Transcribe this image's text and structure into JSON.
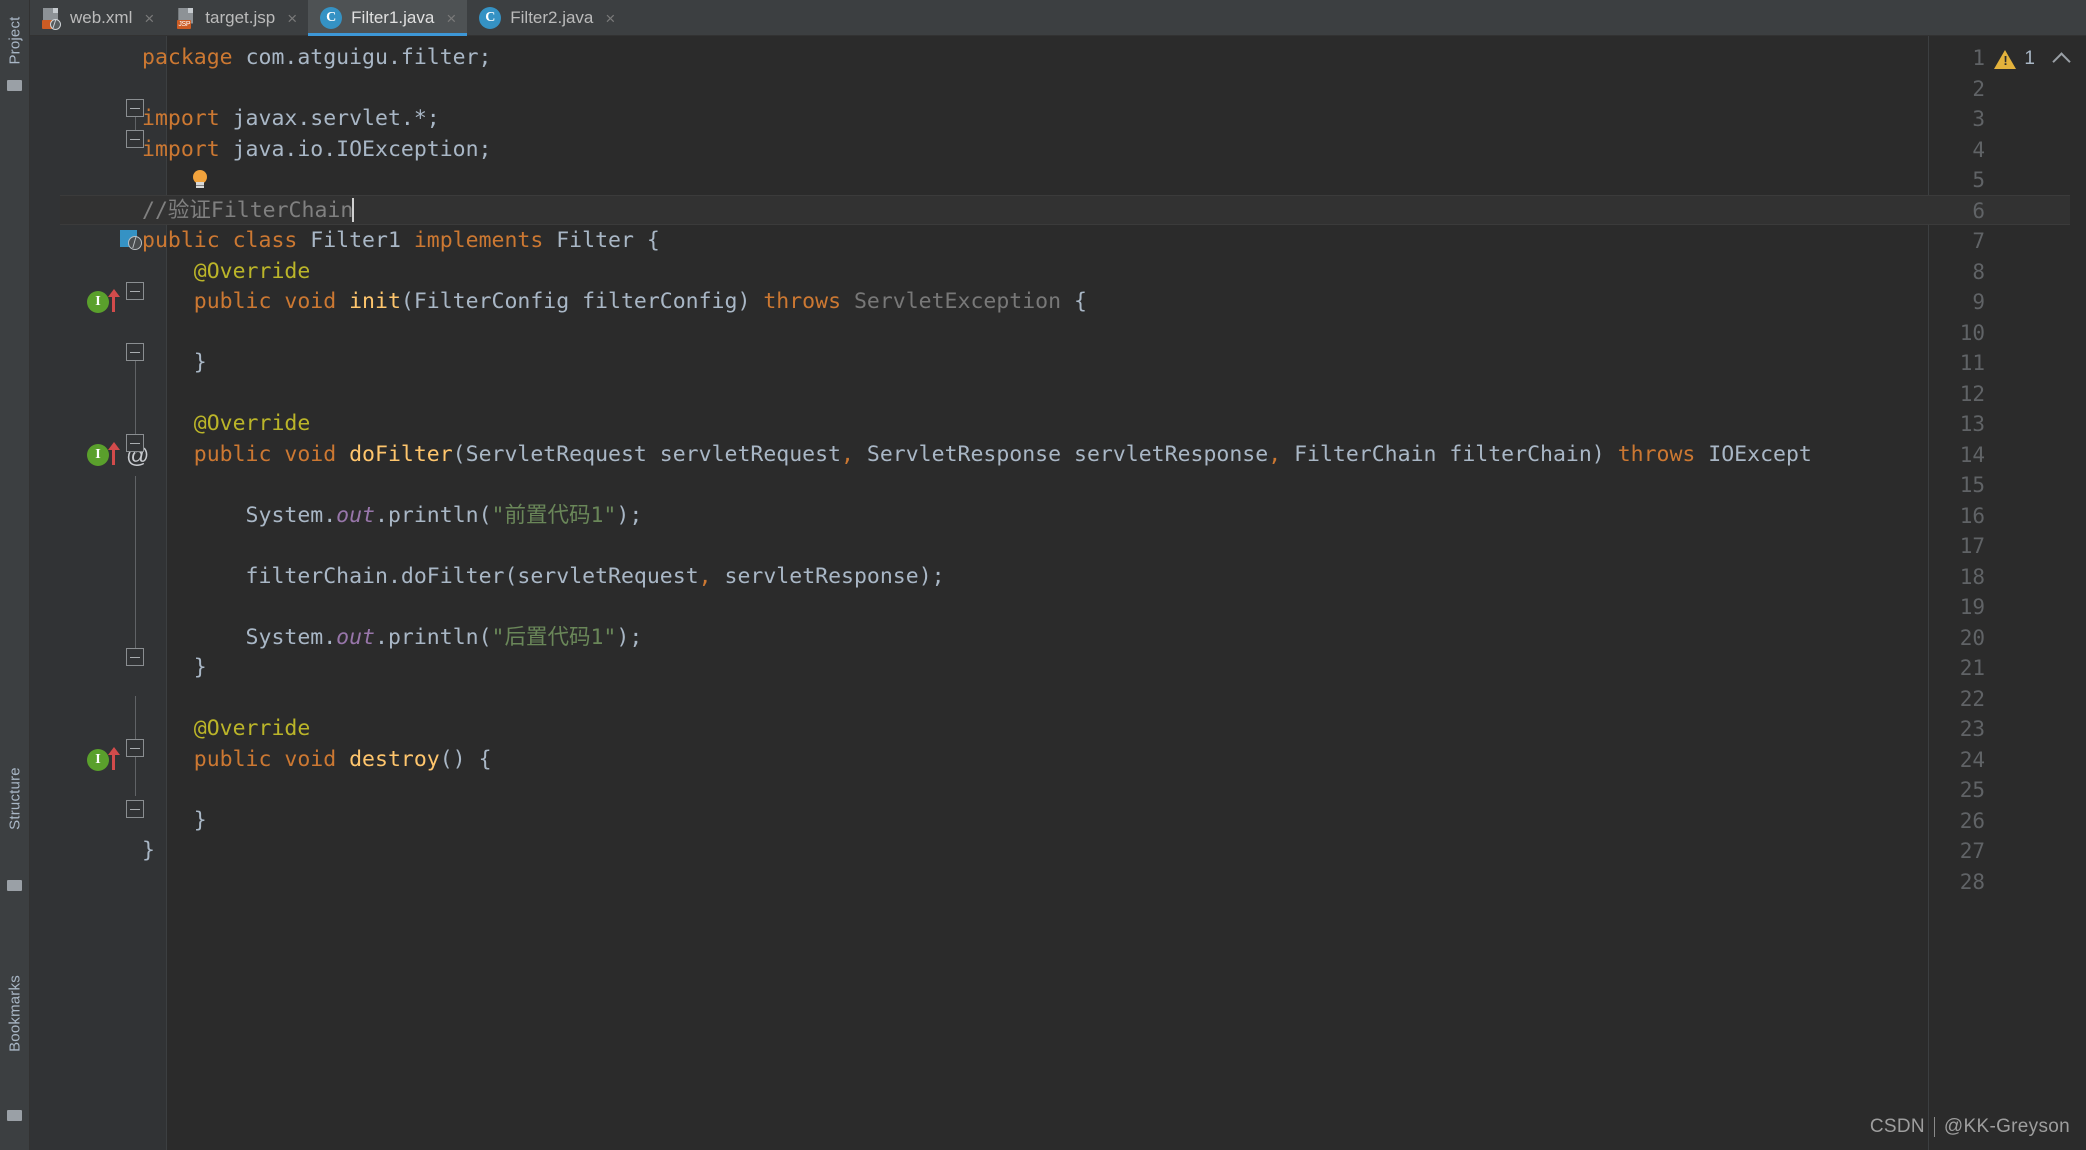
{
  "window": {
    "theme_bg": "#2b2b2b",
    "gutter_bg": "#313335",
    "accent": "#3d97d7"
  },
  "left_rail": {
    "labels": [
      {
        "name": "project",
        "text": "Project"
      },
      {
        "name": "structure",
        "text": "Structure"
      },
      {
        "name": "bookmarks",
        "text": "Bookmarks"
      }
    ]
  },
  "tabs": [
    {
      "label": "web.xml",
      "icon": "xml-file-icon",
      "badge": "",
      "active": false,
      "close": "×"
    },
    {
      "label": "target.jsp",
      "icon": "jsp-file-icon",
      "badge": "JSP",
      "active": false,
      "close": "×"
    },
    {
      "label": "Filter1.java",
      "icon": "java-class-icon",
      "badge": "C",
      "active": true,
      "close": "×"
    },
    {
      "label": "Filter2.java",
      "icon": "java-class-icon",
      "badge": "C",
      "active": false,
      "close": "×"
    }
  ],
  "inspection_widget": {
    "warning_count": "1",
    "icon": "warning-triangle-icon",
    "collapse_icon": "chevron-up-icon"
  },
  "editor": {
    "caret_line": 6,
    "lines": [
      {
        "n": "1",
        "segments": [
          {
            "t": "package ",
            "c": "kw"
          },
          {
            "t": "com.atguigu.filter;",
            "c": "punct"
          }
        ]
      },
      {
        "n": "2",
        "segments": []
      },
      {
        "n": "3",
        "segments": [
          {
            "t": "import ",
            "c": "kw"
          },
          {
            "t": "javax.servlet.*;",
            "c": "punct"
          }
        ]
      },
      {
        "n": "4",
        "segments": [
          {
            "t": "import ",
            "c": "kw"
          },
          {
            "t": "java.io.IOException;",
            "c": "punct"
          }
        ]
      },
      {
        "n": "5",
        "segments": []
      },
      {
        "n": "6",
        "segments": [
          {
            "t": "//验证FilterChain",
            "c": "cmt"
          }
        ],
        "caret": true
      },
      {
        "n": "7",
        "segments": [
          {
            "t": "public class ",
            "c": "kw"
          },
          {
            "t": "Filter1 ",
            "c": "punct"
          },
          {
            "t": "implements ",
            "c": "kw"
          },
          {
            "t": "Filter ",
            "c": "punct"
          },
          {
            "t": "{",
            "c": "punct"
          }
        ]
      },
      {
        "n": "8",
        "segments": [
          {
            "t": "    @Override",
            "c": "anno"
          }
        ]
      },
      {
        "n": "9",
        "segments": [
          {
            "t": "    public void ",
            "c": "kw"
          },
          {
            "t": "init",
            "c": "mth"
          },
          {
            "t": "(",
            "c": "punct"
          },
          {
            "t": "FilterConfig filterConfig",
            "c": "punct"
          },
          {
            "t": ") ",
            "c": "punct"
          },
          {
            "t": "throws ",
            "c": "kw"
          },
          {
            "t": "ServletException ",
            "c": "dim"
          },
          {
            "t": "{",
            "c": "punct"
          }
        ]
      },
      {
        "n": "10",
        "segments": []
      },
      {
        "n": "11",
        "segments": [
          {
            "t": "    }",
            "c": "punct"
          }
        ]
      },
      {
        "n": "12",
        "segments": []
      },
      {
        "n": "13",
        "segments": [
          {
            "t": "    @Override",
            "c": "anno"
          }
        ]
      },
      {
        "n": "14",
        "segments": [
          {
            "t": "    public void ",
            "c": "kw"
          },
          {
            "t": "doFilter",
            "c": "mth"
          },
          {
            "t": "(",
            "c": "punct"
          },
          {
            "t": "ServletRequest servletRequest",
            "c": "punct"
          },
          {
            "t": ", ",
            "c": "kw"
          },
          {
            "t": "ServletResponse servletResponse",
            "c": "punct"
          },
          {
            "t": ", ",
            "c": "kw"
          },
          {
            "t": "FilterChain filterChain",
            "c": "punct"
          },
          {
            "t": ") ",
            "c": "punct"
          },
          {
            "t": "throws ",
            "c": "kw"
          },
          {
            "t": "IOExcept",
            "c": "punct"
          }
        ]
      },
      {
        "n": "15",
        "segments": []
      },
      {
        "n": "16",
        "segments": [
          {
            "t": "        System",
            "c": "punct"
          },
          {
            "t": ".",
            "c": "punct"
          },
          {
            "t": "out",
            "c": "fld"
          },
          {
            "t": ".",
            "c": "punct"
          },
          {
            "t": "println",
            "c": "punct"
          },
          {
            "t": "(",
            "c": "punct"
          },
          {
            "t": "\"前置代码1\"",
            "c": "str"
          },
          {
            "t": ");",
            "c": "punct"
          }
        ]
      },
      {
        "n": "17",
        "segments": []
      },
      {
        "n": "18",
        "segments": [
          {
            "t": "        filterChain",
            "c": "punct"
          },
          {
            "t": ".",
            "c": "punct"
          },
          {
            "t": "doFilter",
            "c": "punct"
          },
          {
            "t": "(",
            "c": "punct"
          },
          {
            "t": "servletRequest",
            "c": "punct"
          },
          {
            "t": ", ",
            "c": "kw"
          },
          {
            "t": "servletResponse",
            "c": "punct"
          },
          {
            "t": ");",
            "c": "punct"
          }
        ]
      },
      {
        "n": "19",
        "segments": []
      },
      {
        "n": "20",
        "segments": [
          {
            "t": "        System",
            "c": "punct"
          },
          {
            "t": ".",
            "c": "punct"
          },
          {
            "t": "out",
            "c": "fld"
          },
          {
            "t": ".",
            "c": "punct"
          },
          {
            "t": "println",
            "c": "punct"
          },
          {
            "t": "(",
            "c": "punct"
          },
          {
            "t": "\"后置代码1\"",
            "c": "str"
          },
          {
            "t": ");",
            "c": "punct"
          }
        ]
      },
      {
        "n": "21",
        "segments": [
          {
            "t": "    }",
            "c": "punct"
          }
        ]
      },
      {
        "n": "22",
        "segments": []
      },
      {
        "n": "23",
        "segments": [
          {
            "t": "    @Override",
            "c": "anno"
          }
        ]
      },
      {
        "n": "24",
        "segments": [
          {
            "t": "    public void ",
            "c": "kw"
          },
          {
            "t": "destroy",
            "c": "mth"
          },
          {
            "t": "() ",
            "c": "punct"
          },
          {
            "t": "{",
            "c": "punct"
          }
        ]
      },
      {
        "n": "25",
        "segments": []
      },
      {
        "n": "26",
        "segments": [
          {
            "t": "    }",
            "c": "punct"
          }
        ]
      },
      {
        "n": "27",
        "segments": [
          {
            "t": "}",
            "c": "punct"
          }
        ]
      },
      {
        "n": "28",
        "segments": []
      }
    ],
    "gutter_icons": [
      {
        "line": 5,
        "name": "intention-lightbulb-icon"
      },
      {
        "line": 7,
        "name": "servlet-class-marker-icon"
      },
      {
        "line": 9,
        "name": "implementing-method-icon"
      },
      {
        "line": 9,
        "name": "overriding-arrow-icon"
      },
      {
        "line": 14,
        "name": "implementing-method-icon"
      },
      {
        "line": 14,
        "name": "overriding-arrow-icon"
      },
      {
        "line": 14,
        "name": "annotation-at-icon"
      },
      {
        "line": 24,
        "name": "implementing-method-icon"
      },
      {
        "line": 24,
        "name": "overriding-arrow-icon"
      }
    ]
  },
  "watermark": {
    "site": "CSDN",
    "author": "@KK-Greyson"
  }
}
